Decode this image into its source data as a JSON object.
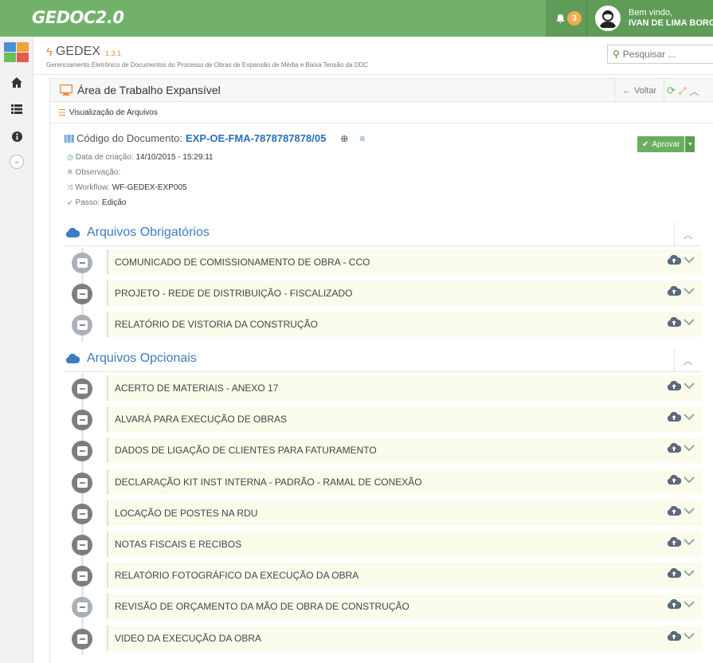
{
  "navbar": {
    "logo": "GEDOC2.0",
    "notification_count": "3",
    "welcome": "Bem vindo,",
    "user_name": "IVAN DE LIMA BORGES"
  },
  "app": {
    "title": "GEDEX",
    "version": "1.3.1",
    "subtitle": "Gerenciamento Eletrônico de Documentos do Processo de Obras de Expansão de Média e Baixa Tensão da DDC",
    "search_placeholder": "Pesquisar ..."
  },
  "panel": {
    "title": "Área de Trabalho Expansível",
    "back_label": "Voltar",
    "subbar_label": "Visualização de Arquivos"
  },
  "document": {
    "code_label": "Código do Documento:",
    "code": "EXP-OE-FMA-7878787878/05",
    "created_label": "Data de criação:",
    "created": "14/10/2015 - 15:29:11",
    "observation_label": "Observação:",
    "observation": "",
    "workflow_label": "Workflow:",
    "workflow": "WF-GEDEX-EXP005",
    "step_label": "Passo:",
    "step": "Edição",
    "approve_label": "Aprovar"
  },
  "required": {
    "title": "Arquivos Obrigatórios",
    "files": [
      "COMUNICADO DE COMISSIONAMENTO DE OBRA - CCO",
      "PROJETO - REDE DE DISTRIBUIÇÃO - FISCALIZADO",
      "RELATÓRIO DE VISTORIA DA CONSTRUÇÃO"
    ]
  },
  "optional": {
    "title": "Arquivos Opcionais",
    "files": [
      "ACERTO DE MATERIAIS - ANEXO 17",
      "ALVARÁ PARA EXECUÇÃO DE OBRAS",
      "DADOS DE LIGAÇÃO DE CLIENTES PARA FATURAMENTO",
      "DECLARAÇÃO KIT INST INTERNA - PADRÃO - RAMAL DE CONEXÃO",
      "LOCAÇÃO DE POSTES NA RDU",
      "NOTAS FISCAIS E RECIBOS",
      "RELATÓRIO FOTOGRÁFICO DA EXECUÇÃO DA OBRA",
      "REVISÃO DE ORÇAMENTO DA MÃO DE OBRA DE CONSTRUÇÃO",
      "VIDEO DA EXECUÇÃO DA OBRA"
    ]
  },
  "colors": {
    "navbar": "#72b16a",
    "accent_orange": "#e9893a",
    "link_blue": "#2a6fb5",
    "approve_green": "#6bae5f",
    "file_card_bg": "#fbfbec"
  },
  "icons": {
    "navbar": [
      "bell-icon",
      "user-avatar-icon",
      "caret-down-icon"
    ],
    "sidebar": [
      "home-icon",
      "list-icon",
      "info-icon",
      "double-chevron-right-icon"
    ],
    "file_actions": [
      "cloud-upload-icon",
      "chevron-down-icon"
    ]
  }
}
